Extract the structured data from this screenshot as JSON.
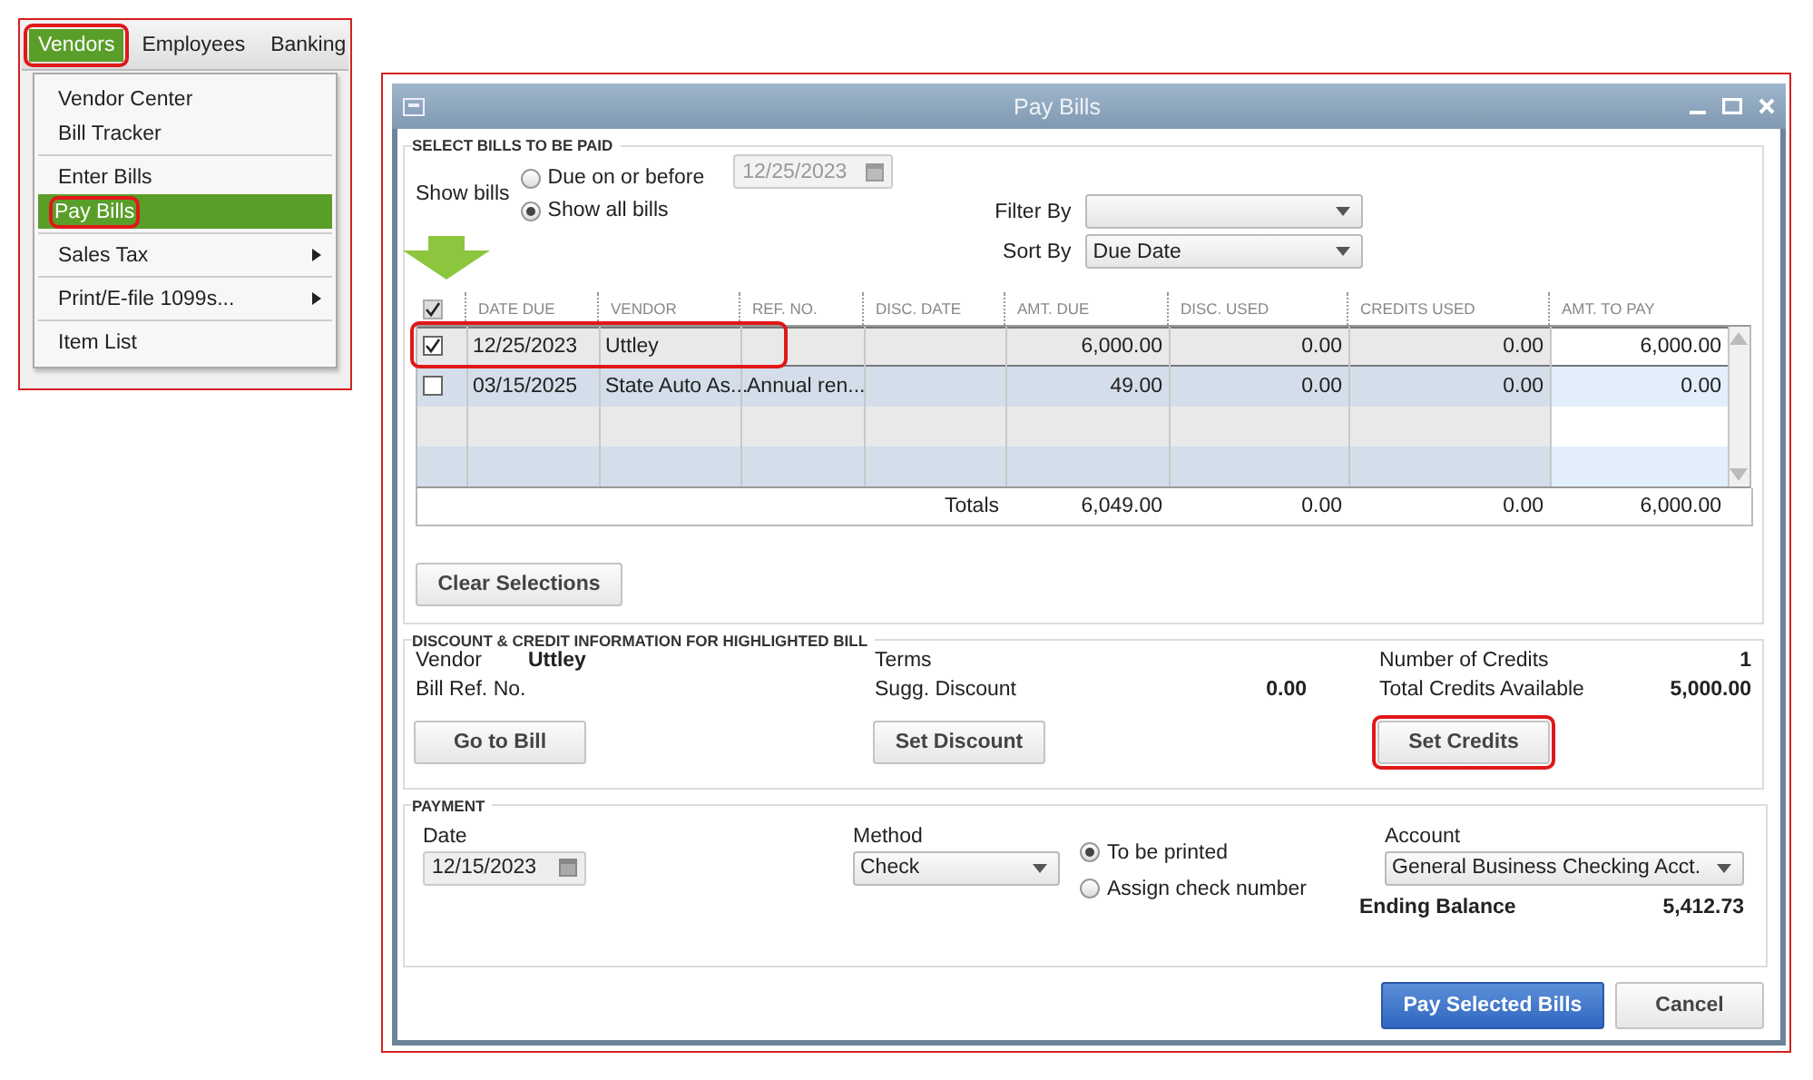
{
  "menu_bar": [
    {
      "label": "Vendors",
      "selected": true,
      "highlighted": true
    },
    {
      "label": "Employees",
      "selected": false,
      "highlighted": false
    },
    {
      "label": "Banking",
      "selected": false,
      "highlighted": false
    }
  ],
  "menu_groups": [
    [
      {
        "label": "Vendor Center",
        "selected": false,
        "highlighted": false,
        "submenu": false
      },
      {
        "label": "Bill Tracker",
        "selected": false,
        "highlighted": false,
        "submenu": false
      }
    ],
    [
      {
        "label": "Enter Bills",
        "selected": false,
        "highlighted": false,
        "submenu": false
      },
      {
        "label": "Pay Bills",
        "selected": true,
        "highlighted": true,
        "submenu": false
      }
    ],
    [
      {
        "label": "Sales Tax",
        "selected": false,
        "highlighted": false,
        "submenu": true
      }
    ],
    [
      {
        "label": "Print/E-file 1099s...",
        "selected": false,
        "highlighted": false,
        "submenu": true
      }
    ],
    [
      {
        "label": "Item List",
        "selected": false,
        "highlighted": false,
        "submenu": false
      }
    ]
  ],
  "window": {
    "title": "Pay Bills"
  },
  "select_bills": {
    "title": "SELECT BILLS TO BE PAID",
    "show_label": "Show bills",
    "options": [
      {
        "label": "Due on or before",
        "selected": false
      },
      {
        "label": "Show all bills",
        "selected": true
      }
    ],
    "due_date": {
      "value": "12/25/2023",
      "disabled": true
    },
    "filter_by": {
      "label": "Filter By"
    },
    "sort_by": {
      "label": "Sort By",
      "value": "Due Date"
    },
    "table": {
      "all_checked": true,
      "columns": [
        "DATE DUE",
        "VENDOR",
        "REF. NO.",
        "DISC. DATE",
        "AMT. DUE",
        "DISC. USED",
        "CREDITS USED",
        "AMT. TO PAY"
      ],
      "rows": [
        {
          "checked": true,
          "selected": true,
          "highlighted": true,
          "cells": [
            "12/25/2023",
            "Uttley",
            "",
            "",
            "6,000.00",
            "0.00",
            "0.00",
            "6,000.00"
          ]
        },
        {
          "checked": false,
          "selected": false,
          "highlighted": false,
          "cells": [
            "03/15/2025",
            "State Auto As...",
            "Annual ren...",
            "",
            "49.00",
            "0.00",
            "0.00",
            "0.00"
          ]
        }
      ],
      "totals": {
        "label": "Totals",
        "values": [
          "6,049.00",
          "0.00",
          "0.00",
          "6,000.00"
        ]
      }
    },
    "clear_button": "Clear Selections"
  },
  "discount": {
    "title": "DISCOUNT & CREDIT INFORMATION FOR HIGHLIGHTED BILL",
    "vendor_label": "Vendor",
    "vendor": "Uttley",
    "ref_label": "Bill Ref. No.",
    "terms_label": "Terms",
    "sugg_label": "Sugg. Discount",
    "sugg_value": "0.00",
    "credits_label": "Number of Credits",
    "credits_value": "1",
    "total_label": "Total Credits Available",
    "total_value": "5,000.00",
    "buttons": [
      {
        "label": "Go to Bill",
        "highlighted": false
      },
      {
        "label": "Set Discount",
        "highlighted": false
      },
      {
        "label": "Set Credits",
        "highlighted": true
      }
    ]
  },
  "payment": {
    "title": "PAYMENT",
    "date_label": "Date",
    "date": "12/15/2023",
    "method_label": "Method",
    "method": "Check",
    "options": [
      {
        "label": "To be printed",
        "selected": true
      },
      {
        "label": "Assign check number",
        "selected": false
      }
    ],
    "account_label": "Account",
    "account": "General Business Checking Acct.",
    "balance_label": "Ending Balance",
    "balance": "5,412.73"
  },
  "buttons": [
    {
      "label": "Pay Selected Bills",
      "kind": "primary"
    },
    {
      "label": "Cancel",
      "kind": "normal"
    }
  ]
}
